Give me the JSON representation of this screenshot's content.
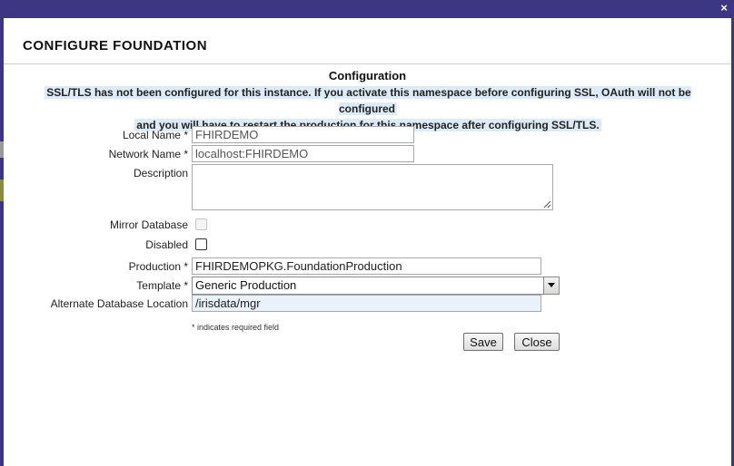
{
  "dialog": {
    "title": "CONFIGURE FOUNDATION",
    "close_glyph": "×"
  },
  "config": {
    "heading": "Configuration",
    "warning_line1": "SSL/TLS has not been configured for this instance. If you activate this namespace before configuring SSL, OAuth will not be configured",
    "warning_line2": "and you will have to restart the production for this namespace after configuring SSL/TLS."
  },
  "form": {
    "local_name": {
      "label": "Local Name *",
      "value": "FHIRDEMO"
    },
    "network_name": {
      "label": "Network Name *",
      "value": "localhost:FHIRDEMO"
    },
    "description": {
      "label": "Description",
      "value": ""
    },
    "mirror_database": {
      "label": "Mirror Database",
      "checked": false,
      "disabled": true
    },
    "disabled": {
      "label": "Disabled",
      "checked": false
    },
    "production": {
      "label": "Production *",
      "value": "FHIRDEMOPKG.FoundationProduction"
    },
    "template": {
      "label": "Template *",
      "value": "Generic Production"
    },
    "alt_db_location": {
      "label": "Alternate Database Location",
      "value": "/irisdata/mgr"
    },
    "required_note": "* indicates required field"
  },
  "buttons": {
    "save": "Save",
    "close": "Close"
  },
  "colors": {
    "title_bar": "#3d3683",
    "warning_highlight": "#dcebf7",
    "alt_db_field_bg": "#e9f1fb"
  }
}
